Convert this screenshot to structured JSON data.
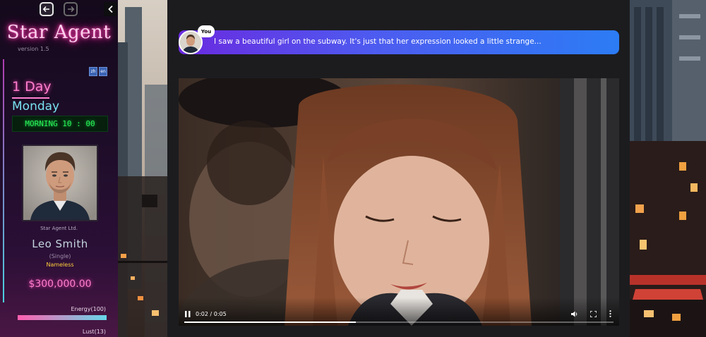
{
  "nav": {
    "back_icon": "arrow-left-icon",
    "forward_icon": "arrow-right-icon",
    "collapse_icon": "chevron-left-icon"
  },
  "sidebar": {
    "game_title": "Star Agent",
    "version": "version 1.5",
    "languages": [
      "zh",
      "en"
    ],
    "day": "1 Day",
    "weekday": "Monday",
    "clock": "MORNING 10 : 00",
    "company": "Star Agent Ltd.",
    "player_name": "Leo Smith",
    "relationship_status": "(Single)",
    "fame_title": "Nameless",
    "money": "$300,000.00",
    "energy_label": "Energy(100)",
    "energy_value": 1.0,
    "lust_label": "Lust(13)"
  },
  "dialog": {
    "speaker": "You",
    "text": "I saw a beautiful girl on the subway. It's just that her expression looked a little strange..."
  },
  "video": {
    "time": "0:02 / 0:05",
    "progress": 0.4,
    "play_icon": "pause-icon",
    "volume_icon": "volume-icon",
    "fullscreen_icon": "fullscreen-icon",
    "more_icon": "more-vertical-icon"
  },
  "colors": {
    "accent_pink": "#ff7fd0",
    "accent_cyan": "#79e2ef",
    "dialog_start": "#6a2ae0",
    "dialog_end": "#2c7cf5",
    "clock_green": "#2af55a"
  }
}
